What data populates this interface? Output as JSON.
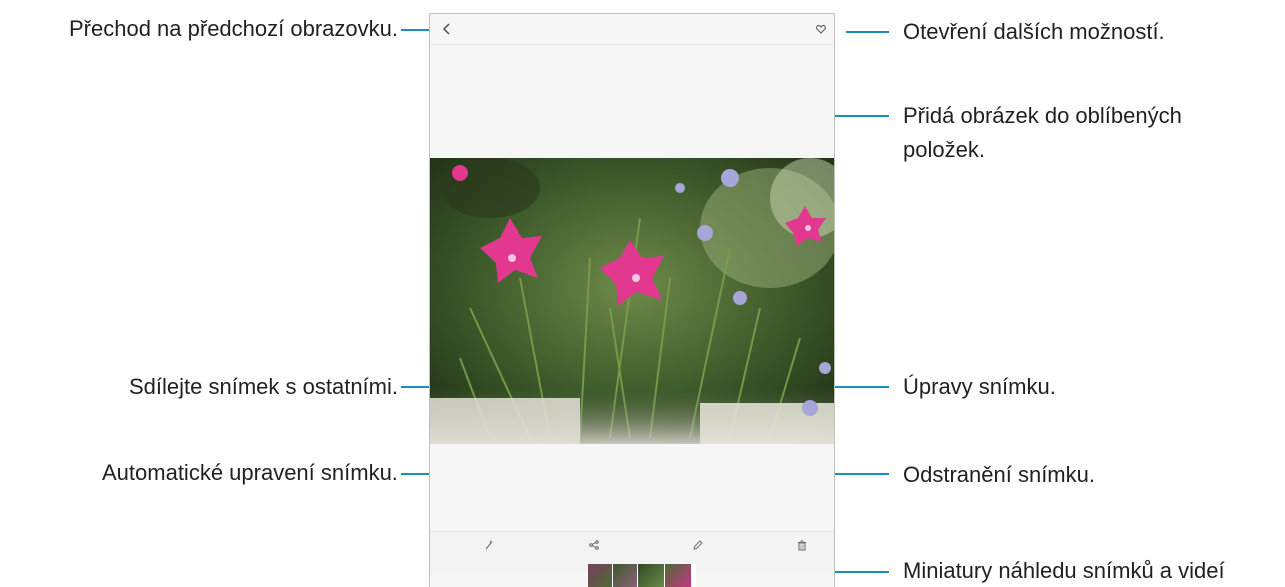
{
  "callouts": {
    "back": "Přechod na předchozí obrazovku.",
    "more": "Otevření dalších možností.",
    "favorite_line1": "Přidá obrázek do oblíbených",
    "favorite_line2": "položek.",
    "share": "Sdílejte snímek s ostatními.",
    "edit": "Úpravy snímku.",
    "auto_adjust": "Automatické upravení snímku.",
    "delete": "Odstranění snímku.",
    "thumbnails": "Miniatury náhledu snímků a videí"
  },
  "icons": {
    "back": "chevron-left-icon",
    "favorite": "heart-icon",
    "more": "more-vertical-icon",
    "auto_adjust": "magic-wand-icon",
    "share": "share-icon",
    "edit": "pencil-icon",
    "delete": "trash-icon"
  },
  "colors": {
    "callout_line": "#1c8bbf"
  }
}
